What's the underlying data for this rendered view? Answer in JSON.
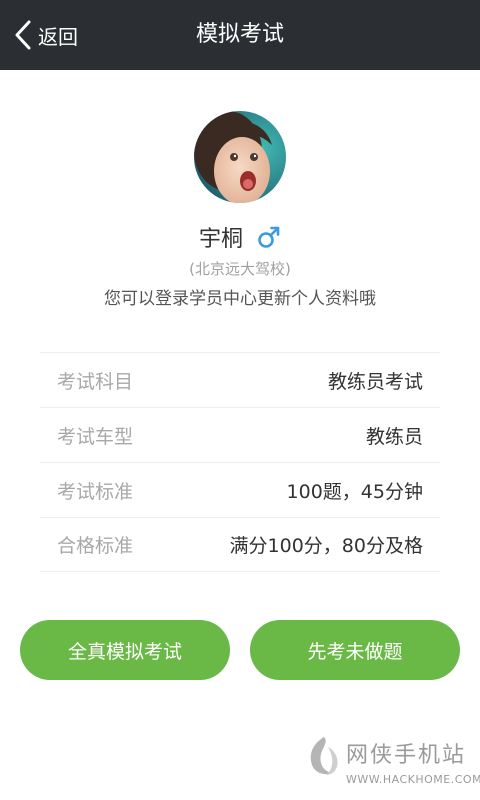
{
  "header": {
    "back_label": "返回",
    "title": "模拟考试",
    "background": "#2b2e33"
  },
  "profile": {
    "name": "宇桐",
    "gender_symbol": "♂",
    "gender_color": "#3b9be0",
    "school": "(北京远大驾校)",
    "hint": "您可以登录学员中心更新个人资料哦"
  },
  "info": {
    "rows": [
      {
        "label": "考试科目",
        "value": "教练员考试"
      },
      {
        "label": "考试车型",
        "value": "教练员"
      },
      {
        "label": "考试标准",
        "value": "100题，45分钟"
      },
      {
        "label": "合格标准",
        "value": "满分100分，80分及格"
      }
    ]
  },
  "actions": {
    "full_exam_label": "全真模拟考试",
    "practice_label": "先考未做题",
    "accent": "#6ab845"
  },
  "watermark": {
    "name": "网侠手机站",
    "url": "WWW.HACKHOME.COM"
  }
}
